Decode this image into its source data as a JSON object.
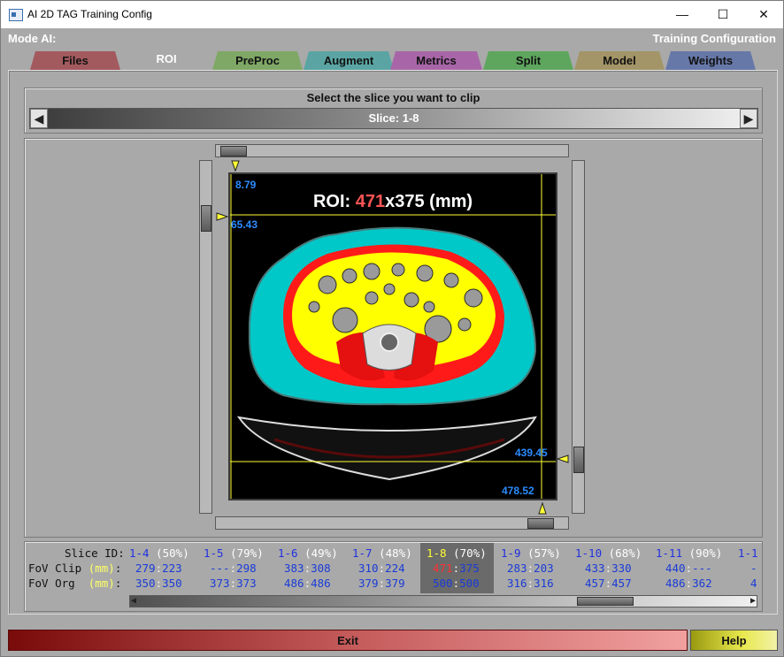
{
  "window": {
    "title": "AI 2D TAG Training Config"
  },
  "header": {
    "mode": "Mode AI:",
    "config": "Training Configuration"
  },
  "tabs": [
    {
      "label": "Files",
      "color": "#a35a5f"
    },
    {
      "label": "ROI",
      "color": "#a9a9a9"
    },
    {
      "label": "PreProc",
      "color": "#7fa866"
    },
    {
      "label": "Augment",
      "color": "#5aa5a3"
    },
    {
      "label": "Metrics",
      "color": "#a866a8"
    },
    {
      "label": "Split",
      "color": "#5ea65e"
    },
    {
      "label": "Model",
      "color": "#a39567"
    },
    {
      "label": "Weights",
      "color": "#6678a8"
    }
  ],
  "slice_select": {
    "label": "Select the slice you want to clip",
    "current": "Slice: 1-8"
  },
  "roi": {
    "prefix": "ROI:",
    "width": "471",
    "x": "x",
    "height": "375",
    "unit": "(mm)",
    "top": "8.79",
    "left": "65.43",
    "right": "439.45",
    "bottom": "478.52"
  },
  "table": {
    "labels": {
      "slice": "Slice ID:",
      "clip_pre": "FoV Clip ",
      "clip_mm": "(mm)",
      "clip_post": ":",
      "org_pre": "FoV Org  ",
      "org_mm": "(mm)",
      "org_post": ":"
    },
    "columns": [
      {
        "id": "1-4",
        "pct": "(50%)",
        "clip_a": "279",
        "clip_b": "223",
        "org_a": "350",
        "org_b": "350"
      },
      {
        "id": "1-5",
        "pct": "(79%)",
        "clip_a": "---",
        "clip_b": "298",
        "org_a": "373",
        "org_b": "373"
      },
      {
        "id": "1-6",
        "pct": "(49%)",
        "clip_a": "383",
        "clip_b": "308",
        "org_a": "486",
        "org_b": "486"
      },
      {
        "id": "1-7",
        "pct": "(48%)",
        "clip_a": "310",
        "clip_b": "224",
        "org_a": "379",
        "org_b": "379"
      },
      {
        "id": "1-8",
        "pct": "(70%)",
        "clip_a": "471",
        "clip_b": "375",
        "org_a": "500",
        "org_b": "500"
      },
      {
        "id": "1-9",
        "pct": "(57%)",
        "clip_a": "283",
        "clip_b": "203",
        "org_a": "316",
        "org_b": "316"
      },
      {
        "id": "1-10",
        "pct": "(68%)",
        "clip_a": "433",
        "clip_b": "330",
        "org_a": "457",
        "org_b": "457"
      },
      {
        "id": "1-11",
        "pct": "(90%)",
        "clip_a": "440",
        "clip_b": "---",
        "org_a": "486",
        "org_b": "362"
      },
      {
        "id": "1-1",
        "pct": "",
        "clip_a": "-",
        "clip_b": "",
        "org_a": "4",
        "org_b": ""
      }
    ]
  },
  "buttons": {
    "exit": "Exit",
    "help": "Help"
  },
  "colors": {
    "selected_id": "#ffff33",
    "selected_clip": "#ff3030"
  }
}
